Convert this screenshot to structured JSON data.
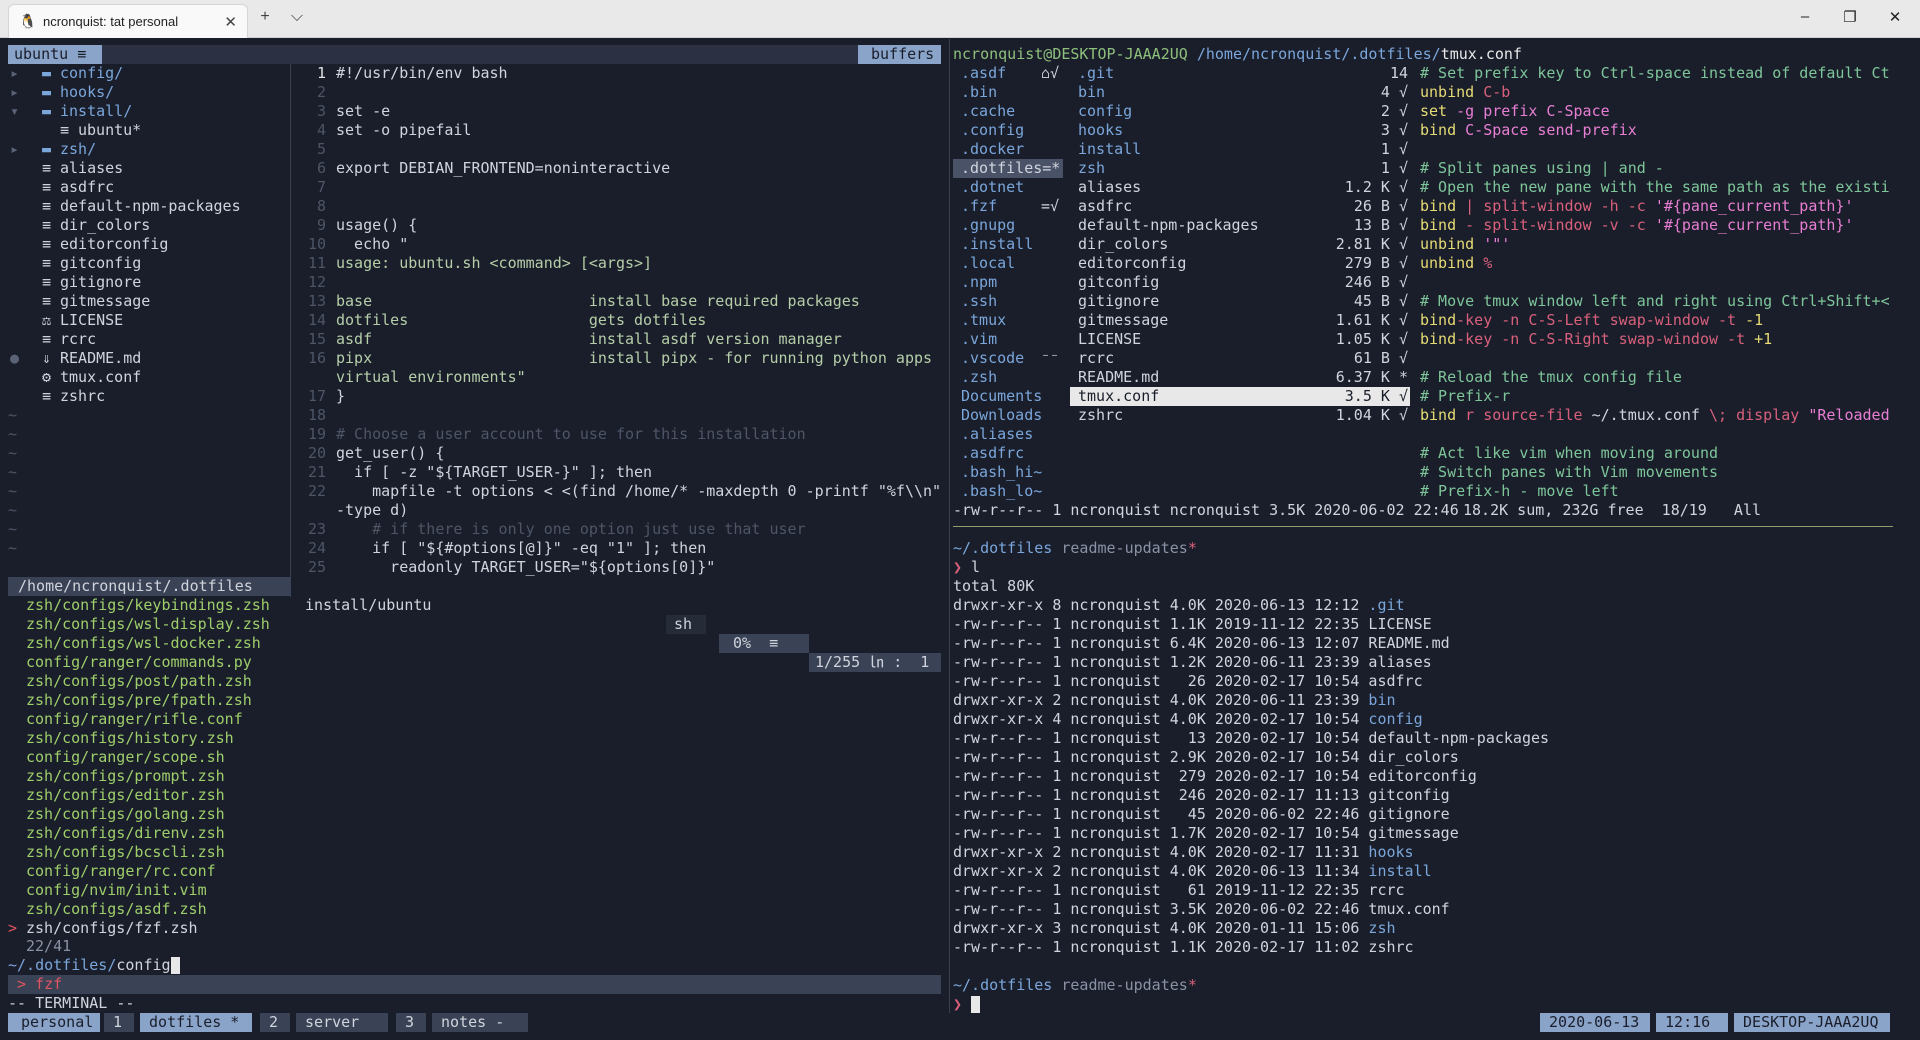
{
  "window": {
    "tab_title": "ncronquist: tat personal",
    "tab_icon": "linux-penguin-icon",
    "new_tab": "+",
    "dropdown": "⌵",
    "minimize": "–",
    "maximize": "❐",
    "close": "✕",
    "tab_close": "✕"
  },
  "nvim": {
    "tree_header": "ubuntu ≡",
    "buffers_label": "buffers",
    "tree": [
      {
        "arrow": "▸",
        "icon": "▬",
        "name": "config/",
        "kind": "dir",
        "indent": 0
      },
      {
        "arrow": "▸",
        "icon": "▬",
        "name": "hooks/",
        "kind": "dir",
        "indent": 0
      },
      {
        "arrow": "▾",
        "icon": "▬",
        "name": "install/",
        "kind": "dir",
        "indent": 0
      },
      {
        "arrow": "",
        "icon": "≡",
        "name": "ubuntu*",
        "kind": "file",
        "indent": 1
      },
      {
        "arrow": "▸",
        "icon": "▬",
        "name": "zsh/",
        "kind": "dir",
        "indent": 0
      },
      {
        "arrow": "",
        "icon": "≡",
        "name": "aliases",
        "kind": "file",
        "indent": 0
      },
      {
        "arrow": "",
        "icon": "≡",
        "name": "asdfrc",
        "kind": "file",
        "indent": 0
      },
      {
        "arrow": "",
        "icon": "≡",
        "name": "default-npm-packages",
        "kind": "file",
        "indent": 0
      },
      {
        "arrow": "",
        "icon": "≡",
        "name": "dir_colors",
        "kind": "file",
        "indent": 0
      },
      {
        "arrow": "",
        "icon": "≡",
        "name": "editorconfig",
        "kind": "file",
        "indent": 0
      },
      {
        "arrow": "",
        "icon": "≡",
        "name": "gitconfig",
        "kind": "file",
        "indent": 0
      },
      {
        "arrow": "",
        "icon": "≡",
        "name": "gitignore",
        "kind": "file",
        "indent": 0
      },
      {
        "arrow": "",
        "icon": "≡",
        "name": "gitmessage",
        "kind": "file",
        "indent": 0
      },
      {
        "arrow": "",
        "icon": "⚖",
        "name": "LICENSE",
        "kind": "file",
        "indent": 0
      },
      {
        "arrow": "",
        "icon": "≡",
        "name": "rcrc",
        "kind": "file",
        "indent": 0
      },
      {
        "arrow": "●",
        "icon": "⇓",
        "name": "README.md",
        "kind": "file",
        "indent": 0
      },
      {
        "arrow": "",
        "icon": "⚙",
        "name": "tmux.conf",
        "kind": "file",
        "indent": 0
      },
      {
        "arrow": "",
        "icon": "≡",
        "name": "zshrc",
        "kind": "file",
        "indent": 0
      }
    ],
    "tildes": [
      "~",
      "~",
      "~",
      "~",
      "~",
      "~",
      "~",
      "~"
    ],
    "code": [
      {
        "n": "1",
        "t": "#!/usr/bin/env bash",
        "cls": "c-file"
      },
      {
        "n": "2",
        "t": "",
        "cls": "c-file"
      },
      {
        "n": "3",
        "t": "set -e",
        "cls": "c-file"
      },
      {
        "n": "4",
        "t": "set -o pipefail",
        "cls": "c-file"
      },
      {
        "n": "5",
        "t": "",
        "cls": "c-file"
      },
      {
        "n": "6",
        "t": "export DEBIAN_FRONTEND=noninteractive",
        "cls": "c-file"
      },
      {
        "n": "7",
        "t": "",
        "cls": "c-file"
      },
      {
        "n": "8",
        "t": "",
        "cls": "c-file"
      },
      {
        "n": "9",
        "t": "usage() {",
        "cls": "c-file"
      },
      {
        "n": "10",
        "t": "  echo \"",
        "cls": "c-file"
      },
      {
        "n": "11",
        "t": "usage: ubuntu.sh <command> [<args>]",
        "cls": "c-green"
      },
      {
        "n": "12",
        "t": "",
        "cls": "c-file"
      },
      {
        "n": "13",
        "t": "base                        install base required packages",
        "cls": "c-green"
      },
      {
        "n": "14",
        "t": "dotfiles                    gets dotfiles",
        "cls": "c-green"
      },
      {
        "n": "15",
        "t": "asdf                        install asdf version manager",
        "cls": "c-green"
      },
      {
        "n": "16",
        "t": "pipx                        install pipx - for running python apps in",
        "cls": "c-green"
      },
      {
        "n": "",
        "t": "virtual environments\"",
        "cls": "c-green"
      },
      {
        "n": "17",
        "t": "}",
        "cls": "c-file"
      },
      {
        "n": "18",
        "t": "",
        "cls": "c-file"
      },
      {
        "n": "19",
        "t": "# Choose a user account to use for this installation",
        "cls": "c-comment"
      },
      {
        "n": "20",
        "t": "get_user() {",
        "cls": "c-file"
      },
      {
        "n": "21",
        "t": "  if [ -z \"${TARGET_USER-}\" ]; then",
        "cls": "c-file"
      },
      {
        "n": "22",
        "t": "    mapfile -t options < <(find /home/* -maxdepth 0 -printf \"%f\\\\n\"",
        "cls": "c-file"
      },
      {
        "n": "",
        "t": "-type d)",
        "cls": "c-file"
      },
      {
        "n": "23",
        "t": "    # if there is only one option just use that user",
        "cls": "c-comment"
      },
      {
        "n": "24",
        "t": "    if [ \"${#options[@]}\" -eq \"1\" ]; then",
        "cls": "c-file"
      },
      {
        "n": "25",
        "t": "      readonly TARGET_USER=\"${options[0]}\"",
        "cls": "c-file"
      }
    ],
    "status_left_path": "/home/ncronquist/.dotfiles",
    "status_file": "install/ubuntu",
    "status_ft": "sh",
    "status_pct": "0%  ≡",
    "status_pos": "1/255 ㏑ :  1"
  },
  "fzf": {
    "results": [
      "zsh/configs/keybindings.zsh",
      "zsh/configs/wsl-display.zsh",
      "zsh/configs/wsl-docker.zsh",
      "config/ranger/commands.py",
      "zsh/configs/post/path.zsh",
      "zsh/configs/pre/fpath.zsh",
      "config/ranger/rifle.conf",
      "zsh/configs/history.zsh",
      "config/ranger/scope.sh",
      "zsh/configs/prompt.zsh",
      "zsh/configs/editor.zsh",
      "zsh/configs/golang.zsh",
      "zsh/configs/direnv.zsh",
      "zsh/configs/bcscli.zsh",
      "config/ranger/rc.conf",
      "config/nvim/init.vim",
      "zsh/configs/asdf.zsh",
      "zsh/configs/fzf.zsh"
    ],
    "selected_marker": ">",
    "count": "22/41",
    "query_prefix": "~/.dotfiles/",
    "query": "config",
    "cmd_bar": " > fzf",
    "mode": "-- TERMINAL --"
  },
  "ranger": {
    "header_user": "ncronquist@DESKTOP-JAAA2UQ",
    "header_path": " /home/ncronquist/.dotfiles/",
    "header_file": "tmux.conf",
    "col1": [
      {
        "name": ".asdf",
        "flag": "⌂√"
      },
      {
        "name": ".bin",
        "flag": ""
      },
      {
        "name": ".cache",
        "flag": ""
      },
      {
        "name": ".config",
        "flag": ""
      },
      {
        "name": ".docker",
        "flag": ""
      },
      {
        "name": ".dotfiles=*",
        "flag": "",
        "sel": true
      },
      {
        "name": ".dotnet",
        "flag": ""
      },
      {
        "name": ".fzf",
        "flag": "=√"
      },
      {
        "name": ".gnupg",
        "flag": ""
      },
      {
        "name": ".install",
        "flag": ""
      },
      {
        "name": ".local",
        "flag": ""
      },
      {
        "name": ".npm",
        "flag": ""
      },
      {
        "name": ".ssh",
        "flag": ""
      },
      {
        "name": ".tmux",
        "flag": ""
      },
      {
        "name": ".vim",
        "flag": ""
      },
      {
        "name": ".vscode",
        "flag": "⁻⁻"
      },
      {
        "name": ".zsh",
        "flag": ""
      },
      {
        "name": "Documents",
        "flag": ""
      },
      {
        "name": "Downloads",
        "flag": ""
      },
      {
        "name": ".aliases",
        "flag": ""
      },
      {
        "name": ".asdfrc",
        "flag": ""
      },
      {
        "name": ".bash_hi~",
        "flag": ""
      },
      {
        "name": ".bash_lo~",
        "flag": ""
      }
    ],
    "col2": [
      {
        "name": ".git",
        "size": "14",
        "mark": ""
      },
      {
        "name": "bin",
        "size": "4 √",
        "mark": ""
      },
      {
        "name": "config",
        "size": "2 √",
        "mark": ""
      },
      {
        "name": "hooks",
        "size": "3 √",
        "mark": ""
      },
      {
        "name": "install",
        "size": "1 √",
        "mark": ""
      },
      {
        "name": "zsh",
        "size": "1 √",
        "mark": ""
      },
      {
        "name": "aliases",
        "size": "1.2 K √",
        "mark": ""
      },
      {
        "name": "asdfrc",
        "size": "26 B √",
        "mark": ""
      },
      {
        "name": "default-npm-packages",
        "size": "13 B √",
        "mark": ""
      },
      {
        "name": "dir_colors",
        "size": "2.81 K √",
        "mark": ""
      },
      {
        "name": "editorconfig",
        "size": "279 B √",
        "mark": ""
      },
      {
        "name": "gitconfig",
        "size": "246 B √",
        "mark": ""
      },
      {
        "name": "gitignore",
        "size": "45 B √",
        "mark": ""
      },
      {
        "name": "gitmessage",
        "size": "1.61 K √",
        "mark": ""
      },
      {
        "name": "LICENSE",
        "size": "1.05 K √",
        "mark": ""
      },
      {
        "name": "rcrc",
        "size": "61 B √",
        "mark": ""
      },
      {
        "name": "README.md",
        "size": "6.37 K *",
        "mark": ""
      },
      {
        "name": "tmux.conf",
        "size": "3.5 K √",
        "mark": "",
        "sel": true
      },
      {
        "name": "zshrc",
        "size": "1.04 K √",
        "mark": ""
      }
    ],
    "preview": [
      [
        {
          "t": "# Set prefix key to Ctrl-space instead of default Ct",
          "c": "c-comment2"
        }
      ],
      [
        {
          "t": "unbind ",
          "c": "c-yellow"
        },
        {
          "t": "C-b",
          "c": "c-pink"
        }
      ],
      [
        {
          "t": "set ",
          "c": "c-yellow"
        },
        {
          "t": "-g prefix C-Space",
          "c": "c-magenta"
        }
      ],
      [
        {
          "t": "bind ",
          "c": "c-yellow"
        },
        {
          "t": "C-Space send-prefix",
          "c": "c-magenta"
        }
      ],
      [
        {
          "t": "",
          "c": "c-file"
        }
      ],
      [
        {
          "t": "# Split panes using | and -",
          "c": "c-comment2"
        }
      ],
      [
        {
          "t": "# Open the new pane with the same path as the existi",
          "c": "c-comment2"
        }
      ],
      [
        {
          "t": "bind ",
          "c": "c-yellow"
        },
        {
          "t": "| split-window -h -c ",
          "c": "c-pink"
        },
        {
          "t": "'#{pane_current_path}'",
          "c": "c-magenta"
        }
      ],
      [
        {
          "t": "bind ",
          "c": "c-yellow"
        },
        {
          "t": "- split-window -v -c ",
          "c": "c-pink"
        },
        {
          "t": "'#{pane_current_path}'",
          "c": "c-magenta"
        }
      ],
      [
        {
          "t": "unbind ",
          "c": "c-yellow"
        },
        {
          "t": "'\"'",
          "c": "c-magenta"
        }
      ],
      [
        {
          "t": "unbind ",
          "c": "c-yellow"
        },
        {
          "t": "%",
          "c": "c-pink"
        }
      ],
      [
        {
          "t": "",
          "c": "c-file"
        }
      ],
      [
        {
          "t": "# Move tmux window left and right using Ctrl+Shift+<",
          "c": "c-comment2"
        }
      ],
      [
        {
          "t": "bind",
          "c": "c-yellow"
        },
        {
          "t": "-key -n C-S-Left swap-window -t ",
          "c": "c-pink"
        },
        {
          "t": "-1",
          "c": "c-yellow"
        }
      ],
      [
        {
          "t": "bind",
          "c": "c-yellow"
        },
        {
          "t": "-key -n C-S-Right swap-window -t ",
          "c": "c-pink"
        },
        {
          "t": "+1",
          "c": "c-yellow"
        }
      ],
      [
        {
          "t": "",
          "c": "c-file"
        }
      ],
      [
        {
          "t": "# Reload the tmux config file",
          "c": "c-comment2"
        }
      ],
      [
        {
          "t": "# Prefix-r",
          "c": "c-comment2"
        }
      ],
      [
        {
          "t": "bind ",
          "c": "c-yellow"
        },
        {
          "t": "r source-file ",
          "c": "c-pink"
        },
        {
          "t": "~/.tmux.conf ",
          "c": "c-file"
        },
        {
          "t": "\\; display ",
          "c": "c-pink"
        },
        {
          "t": "\"Reloaded",
          "c": "c-magenta"
        }
      ],
      [
        {
          "t": "",
          "c": "c-file"
        }
      ],
      [
        {
          "t": "# Act like vim when moving around",
          "c": "c-comment2"
        }
      ],
      [
        {
          "t": "# Switch panes with Vim movements",
          "c": "c-comment2"
        }
      ],
      [
        {
          "t": "# Prefix-h - move left",
          "c": "c-comment2"
        }
      ]
    ],
    "status": "-rw-r--r-- 1 ncronquist ncronquist 3.5K 2020-06-02 22:46",
    "status_right": "18.2K sum, 232G free  18/19   All"
  },
  "shell": {
    "prompt_dir": "~/.dotfiles",
    "branch": " readme-updates",
    "dirty": "*",
    "prompt_char": "❯",
    "cmd": " l",
    "total": "total 80K",
    "listing": [
      {
        "perm": "drwxr-xr-x 8 ncronquist 4.0K 2020-06-13 12:12 ",
        "name": ".git",
        "dir": true
      },
      {
        "perm": "-rw-r--r-- 1 ncronquist 1.1K 2019-11-12 22:35 ",
        "name": "LICENSE",
        "dir": false
      },
      {
        "perm": "-rw-r--r-- 1 ncronquist 6.4K 2020-06-13 12:07 ",
        "name": "README.md",
        "dir": false
      },
      {
        "perm": "-rw-r--r-- 1 ncronquist 1.2K 2020-06-11 23:39 ",
        "name": "aliases",
        "dir": false
      },
      {
        "perm": "-rw-r--r-- 1 ncronquist   26 2020-02-17 10:54 ",
        "name": "asdfrc",
        "dir": false
      },
      {
        "perm": "drwxr-xr-x 2 ncronquist 4.0K 2020-06-11 23:39 ",
        "name": "bin",
        "dir": true
      },
      {
        "perm": "drwxr-xr-x 4 ncronquist 4.0K 2020-02-17 10:54 ",
        "name": "config",
        "dir": true
      },
      {
        "perm": "-rw-r--r-- 1 ncronquist   13 2020-02-17 10:54 ",
        "name": "default-npm-packages",
        "dir": false
      },
      {
        "perm": "-rw-r--r-- 1 ncronquist 2.9K 2020-02-17 10:54 ",
        "name": "dir_colors",
        "dir": false
      },
      {
        "perm": "-rw-r--r-- 1 ncronquist  279 2020-02-17 10:54 ",
        "name": "editorconfig",
        "dir": false
      },
      {
        "perm": "-rw-r--r-- 1 ncronquist  246 2020-02-17 11:13 ",
        "name": "gitconfig",
        "dir": false
      },
      {
        "perm": "-rw-r--r-- 1 ncronquist   45 2020-06-02 22:46 ",
        "name": "gitignore",
        "dir": false
      },
      {
        "perm": "-rw-r--r-- 1 ncronquist 1.7K 2020-02-17 10:54 ",
        "name": "gitmessage",
        "dir": false
      },
      {
        "perm": "drwxr-xr-x 2 ncronquist 4.0K 2020-02-17 11:31 ",
        "name": "hooks",
        "dir": true
      },
      {
        "perm": "drwxr-xr-x 2 ncronquist 4.0K 2020-06-13 11:34 ",
        "name": "install",
        "dir": true
      },
      {
        "perm": "-rw-r--r-- 1 ncronquist   61 2019-11-12 22:35 ",
        "name": "rcrc",
        "dir": false
      },
      {
        "perm": "-rw-r--r-- 1 ncronquist 3.5K 2020-06-02 22:46 ",
        "name": "tmux.conf",
        "dir": false
      },
      {
        "perm": "drwxr-xr-x 3 ncronquist 4.0K 2020-01-11 15:06 ",
        "name": "zsh",
        "dir": true
      },
      {
        "perm": "-rw-r--r-- 1 ncronquist 1.1K 2020-02-17 11:02 ",
        "name": "zshrc",
        "dir": false
      }
    ]
  },
  "tmux": {
    "session": " personal ",
    "windows": [
      {
        "num": " 1 ",
        "name": " dotfiles * ",
        "active": true
      },
      {
        "num": " 2 ",
        "name": " server ",
        "active": false
      },
      {
        "num": " 3 ",
        "name": " notes - ",
        "active": false
      }
    ],
    "date": " 2020-06-13 ",
    "time": " 12:16 ",
    "host": " DESKTOP-JAAA2UQ "
  },
  "colors": {
    "bg": "#1a1e2b",
    "accent": "#7aa6da",
    "status_bg": "#3a4255"
  }
}
